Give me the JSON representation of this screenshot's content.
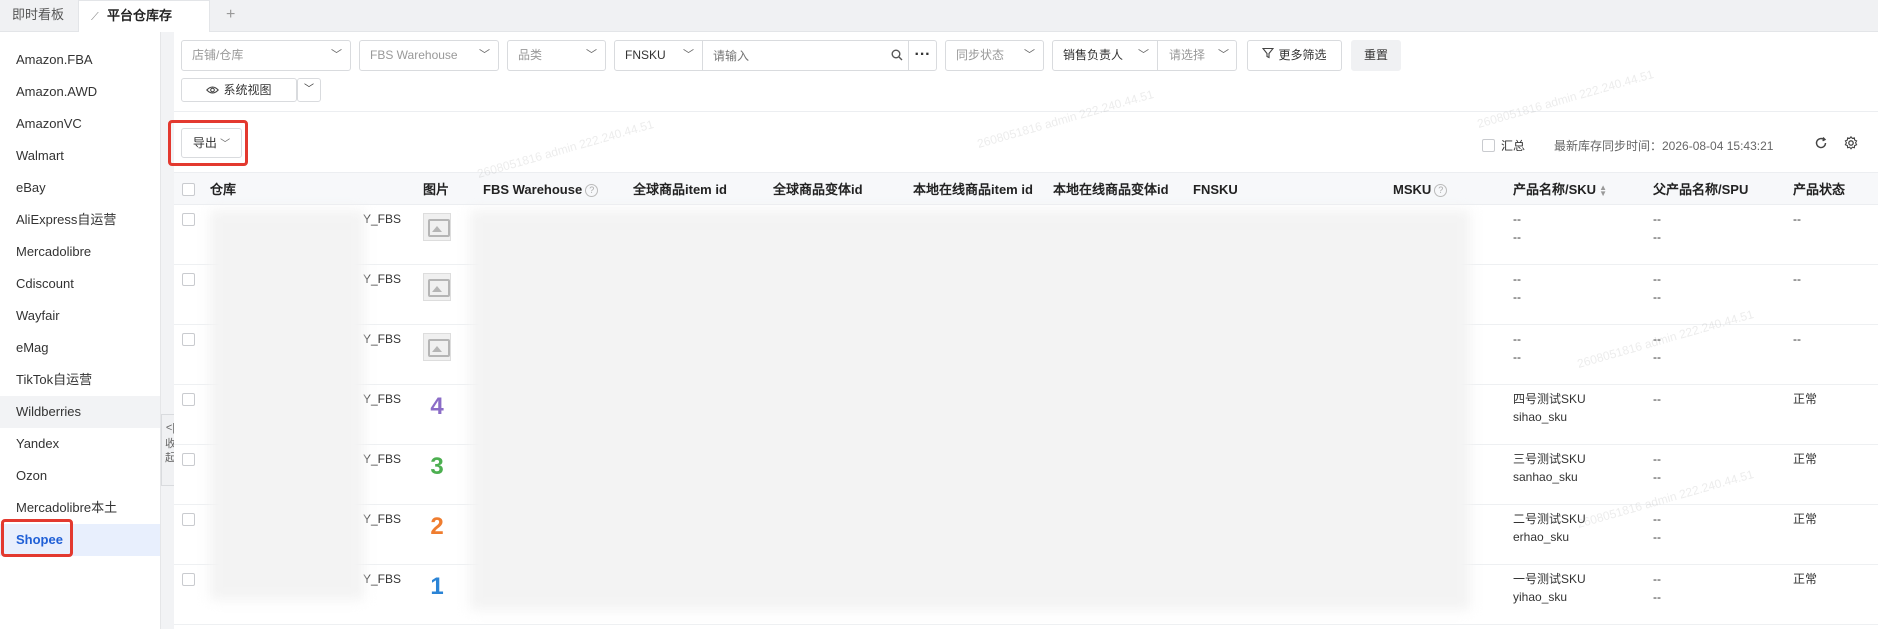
{
  "tabs": {
    "dashboard": "即时看板",
    "inventory": "平台仓库存",
    "add": "+"
  },
  "sidebar": {
    "items": [
      {
        "label": "Amazon.FBA"
      },
      {
        "label": "Amazon.AWD"
      },
      {
        "label": "AmazonVC"
      },
      {
        "label": "Walmart"
      },
      {
        "label": "eBay"
      },
      {
        "label": "AliExpress自运营"
      },
      {
        "label": "Mercadolibre"
      },
      {
        "label": "Cdiscount"
      },
      {
        "label": "Wayfair"
      },
      {
        "label": "eMag"
      },
      {
        "label": "TikTok自运营"
      },
      {
        "label": "Wildberries"
      },
      {
        "label": "Yandex"
      },
      {
        "label": "Ozon"
      },
      {
        "label": "Mercadolibre本土"
      },
      {
        "label": "Shopee"
      }
    ],
    "collapse_label": "收起"
  },
  "filters": {
    "store": "店铺/仓库",
    "warehouse": "FBS Warehouse",
    "category": "品类",
    "fnsku": "FNSKU",
    "search_placeholder": "请输入",
    "sync_status": "同步状态",
    "sales_owner": "销售负责人",
    "select_placeholder": "请选择",
    "more_filters": "更多筛选",
    "reset": "重置",
    "system_view": "系统视图"
  },
  "toolbar": {
    "export": "导出",
    "summary": "汇总",
    "sync_time": "最新库存同步时间：2026-08-04 15:43:21"
  },
  "table": {
    "headers": {
      "warehouse": "仓库",
      "image": "图片",
      "fbs_warehouse": "FBS Warehouse",
      "global_item_id": "全球商品item id",
      "global_variant_id": "全球商品变体id",
      "local_item_id": "本地在线商品item id",
      "local_variant_id": "本地在线商品变体id",
      "fnsku": "FNSKU",
      "msku": "MSKU",
      "product_name_sku": "产品名称/SKU",
      "parent_name_spu": "父产品名称/SPU",
      "product_status": "产品状态"
    },
    "rows": [
      {
        "warehouse": "Y_FBS",
        "image": "placeholder",
        "name": "--",
        "sku": "--",
        "parent": "--",
        "spu": "--",
        "status": "--"
      },
      {
        "warehouse": "Y_FBS",
        "image": "placeholder",
        "name": "--",
        "sku": "--",
        "parent": "--",
        "spu": "--",
        "status": "--"
      },
      {
        "warehouse": "Y_FBS",
        "image": "placeholder",
        "name": "--",
        "sku": "--",
        "parent": "--",
        "spu": "--",
        "status": "--"
      },
      {
        "warehouse": "Y_FBS",
        "image": "4",
        "image_color": "#8b6cc7",
        "name": "四号测试SKU",
        "sku": "sihao_sku",
        "parent": "--",
        "spu": "",
        "status": "正常"
      },
      {
        "warehouse": "Y_FBS",
        "image": "3",
        "image_color": "#4caf50",
        "name": "三号测试SKU",
        "sku": "sanhao_sku",
        "parent": "--",
        "spu": "--",
        "status": "正常"
      },
      {
        "warehouse": "Y_FBS",
        "image": "2",
        "image_color": "#ef7d2f",
        "name": "二号测试SKU",
        "sku": "erhao_sku",
        "parent": "--",
        "spu": "--",
        "status": "正常"
      },
      {
        "warehouse": "Y_FBS",
        "image": "1",
        "image_color": "#2b84d6",
        "name": "一号测试SKU",
        "sku": "yihao_sku",
        "parent": "--",
        "spu": "--",
        "status": "正常"
      }
    ]
  },
  "colors": {
    "highlight": "#e3392f",
    "active_nav": "#1f5fd6"
  }
}
